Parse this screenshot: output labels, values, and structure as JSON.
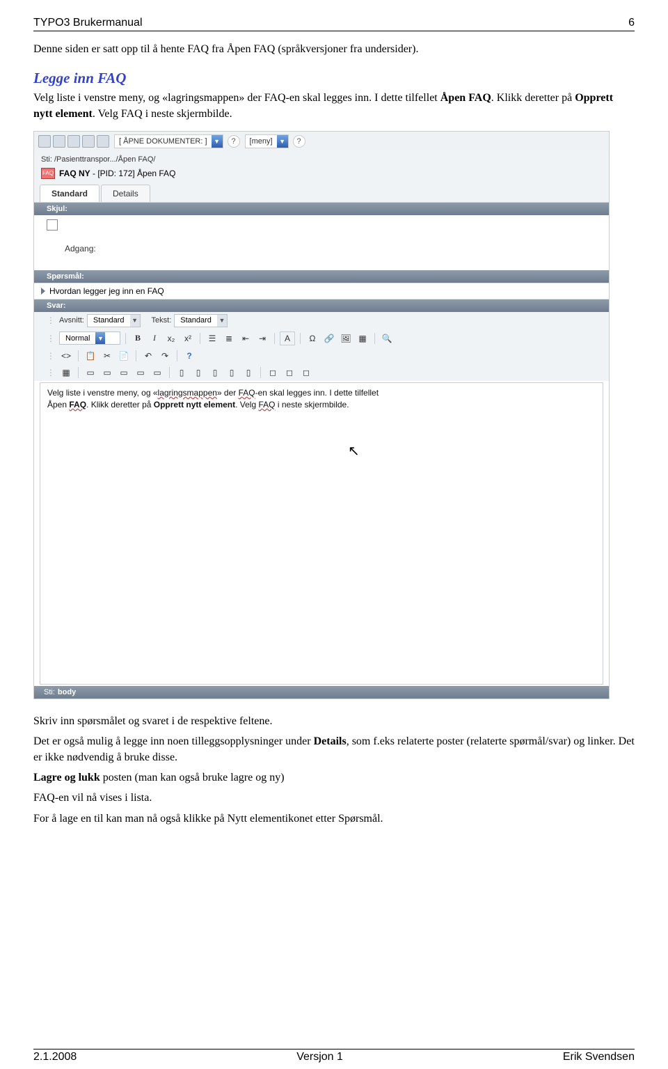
{
  "header": {
    "left": "TYPO3   Brukermanual",
    "right": "6"
  },
  "intro": "Denne siden er satt opp til å hente FAQ fra Åpen FAQ (språkversjoner fra undersider).",
  "heading": "Legge inn FAQ",
  "para1": {
    "a": "Velg liste i venstre meny, og «lagringsmappen» der FAQ-en skal legges inn. I dette tilfellet ",
    "b": "Åpen FAQ",
    "c": ". Klikk deretter på ",
    "d": "Opprett nytt element",
    "e": ". Velg FAQ i neste skjermbilde."
  },
  "ss": {
    "open_docs": "[ ÅPNE DOKUMENTER: ]",
    "meny": "[meny]",
    "path_label": "Sti: /Pasienttranspor.../Åpen FAQ/",
    "faq_badge": "FAQ",
    "title_a": "FAQ NY",
    "title_b": " - [PID: 172] Åpen FAQ",
    "tab1": "Standard",
    "tab2": "Details",
    "sec_skjul": "Skjul:",
    "adgang": "Adgang:",
    "sec_sporsmal": "Spørsmål:",
    "question": "Hvordan legger jeg inn en FAQ",
    "sec_svar": "Svar:",
    "rte": {
      "avsnitt_label": "Avsnitt:",
      "avsnitt_val": "Standard",
      "tekst_label": "Tekst:",
      "tekst_val": "Standard",
      "normal": "Normal",
      "bold": "B",
      "italic": "I",
      "sub": "x₂",
      "sup": "x²",
      "a_btn": "A",
      "omega": "Ω",
      "code": "<>",
      "help": "?",
      "binoc": "🔍"
    },
    "editor": {
      "t1": "Velg liste i venstre meny, og «",
      "t2": "lagringsmappen",
      "t3": "» der ",
      "t4": "FAQ",
      "t5": "-en skal legges inn. I dette tilfellet ",
      "t6": "Åpen",
      "t7": " ",
      "t8": "FAQ",
      "t9": ". Klikk deretter på ",
      "t10": "Opprett nytt element",
      "t11": ". Velg ",
      "t12": "FAQ",
      "t13": " i neste skjermbilde."
    },
    "status_label": "Sti:",
    "status_val": "body"
  },
  "after": {
    "p1": "Skriv inn spørsmålet og svaret i de respektive feltene.",
    "p2a": "Det er også mulig å legge inn noen tilleggsopplysninger under ",
    "p2b": "Details",
    "p2c": ", som f.eks relaterte poster (relaterte spørmål/svar) og linker. Det er ikke nødvendig å bruke disse.",
    "p3a": "Lagre og lukk",
    "p3b": " posten (man kan også bruke lagre og ny)",
    "p4": "FAQ-en vil nå vises i lista.",
    "p5": "For å lage en til kan man nå også klikke på Nytt elementikonet etter Spørsmål."
  },
  "footer": {
    "left": "2.1.2008",
    "mid": "Versjon 1",
    "right": "Erik Svendsen"
  }
}
